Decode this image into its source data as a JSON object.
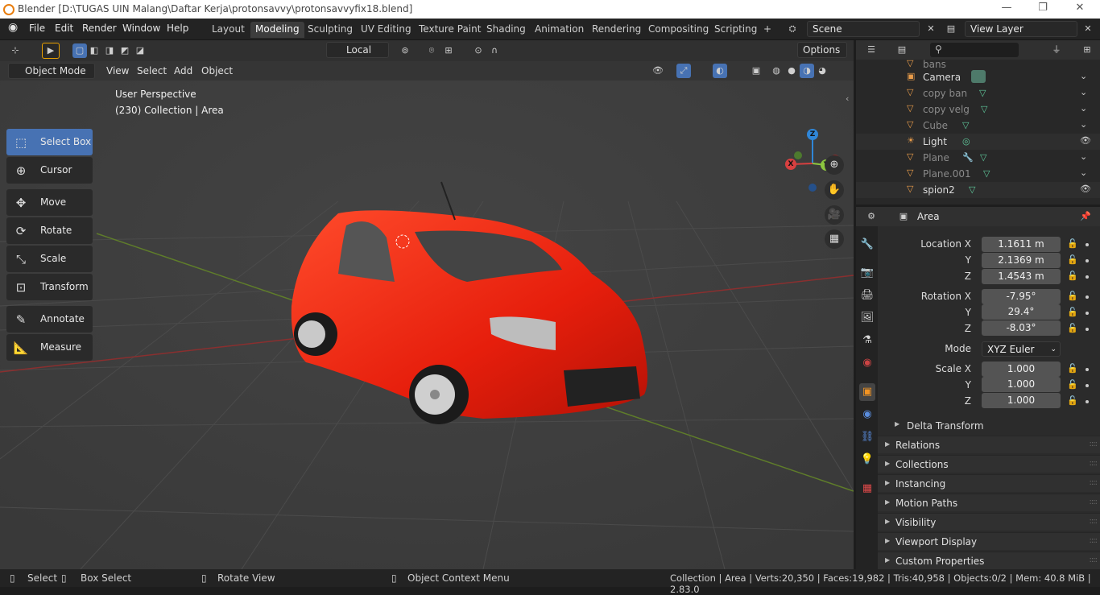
{
  "window": {
    "title": "Blender [D:\\TUGAS UIN Malang\\Daftar Kerja\\protonsavvy\\protonsavvyfix18.blend]"
  },
  "menus": [
    "File",
    "Edit",
    "Render",
    "Window",
    "Help"
  ],
  "workspaces": [
    "Layout",
    "Modeling",
    "Sculpting",
    "UV Editing",
    "Texture Paint",
    "Shading",
    "Animation",
    "Rendering",
    "Compositing",
    "Scripting"
  ],
  "active_workspace": "Modeling",
  "scene": {
    "label": "Scene",
    "view_layer": "View Layer"
  },
  "viewport_header": {
    "orientation": "Local",
    "options": "Options",
    "mode": "Object Mode",
    "menus": [
      "View",
      "Select",
      "Add",
      "Object"
    ]
  },
  "tools": [
    "Select Box",
    "Cursor",
    "Move",
    "Rotate",
    "Scale",
    "Transform",
    "Annotate",
    "Measure"
  ],
  "viewport_info": {
    "perspective": "User Perspective",
    "collection": "(230) Collection | Area"
  },
  "gizmo": {
    "x": "X",
    "y": "Y",
    "z": "Z"
  },
  "outliner": {
    "items": [
      {
        "name": "bans",
        "dim": true
      },
      {
        "name": "Camera",
        "dim": false
      },
      {
        "name": "copy ban",
        "dim": true
      },
      {
        "name": "copy velg",
        "dim": true
      },
      {
        "name": "Cube",
        "dim": true
      },
      {
        "name": "Light",
        "dim": false
      },
      {
        "name": "Plane",
        "dim": true
      },
      {
        "name": "Plane.001",
        "dim": true
      },
      {
        "name": "spion2",
        "dim": false
      }
    ]
  },
  "properties": {
    "object_name": "Area",
    "location": {
      "label": "Location X",
      "x": "1.1611 m",
      "y": "2.1369 m",
      "z": "1.4543 m"
    },
    "rotation": {
      "label": "Rotation X",
      "x": "-7.95°",
      "y": "29.4°",
      "z": "-8.03°"
    },
    "mode": {
      "label": "Mode",
      "value": "XYZ Euler"
    },
    "scale": {
      "label": "Scale X",
      "x": "1.000",
      "y": "1.000",
      "z": "1.000"
    },
    "axis_y": "Y",
    "axis_z": "Z",
    "delta": "Delta Transform",
    "panels": [
      "Relations",
      "Collections",
      "Instancing",
      "Motion Paths",
      "Visibility",
      "Viewport Display",
      "Custom Properties"
    ]
  },
  "statusbar": {
    "select": "Select",
    "box_select": "Box Select",
    "rotate_view": "Rotate View",
    "context_menu": "Object Context Menu",
    "stats": "Collection | Area | Verts:20,350 | Faces:19,982 | Tris:40,958 | Objects:0/2 | Mem: 40.8 MiB | 2.83.0"
  }
}
